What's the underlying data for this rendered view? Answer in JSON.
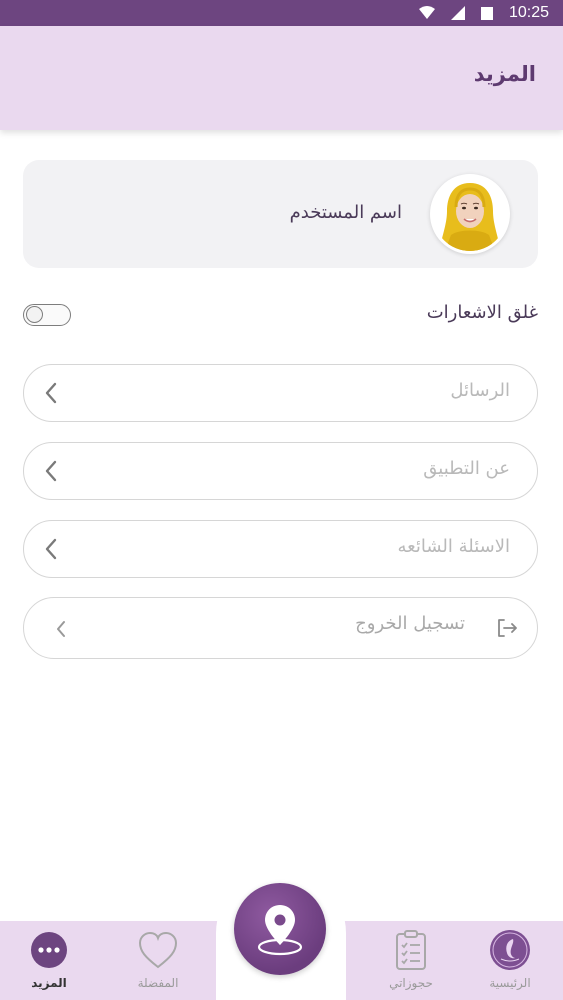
{
  "status_bar": {
    "time": "10:25"
  },
  "app_bar": {
    "title": "المزيد"
  },
  "profile": {
    "username": "اسم المستخدم"
  },
  "notifications": {
    "label": "غلق الاشعارات",
    "enabled": false
  },
  "menu": {
    "messages": "الرسائل",
    "about": "عن التطبيق",
    "faq": "الاسئلة الشائعه",
    "logout": "تسجيل الخروج"
  },
  "bottom_nav": {
    "home": "الرئيسية",
    "bookings": "حجوزاتي",
    "favorites": "المفضلة",
    "more": "المزيد"
  },
  "colors": {
    "primary": "#6d4580",
    "app_bar_bg": "#ead9ef",
    "card_bg": "#f2f2f4",
    "avatar_scarf": "#f0c020"
  }
}
